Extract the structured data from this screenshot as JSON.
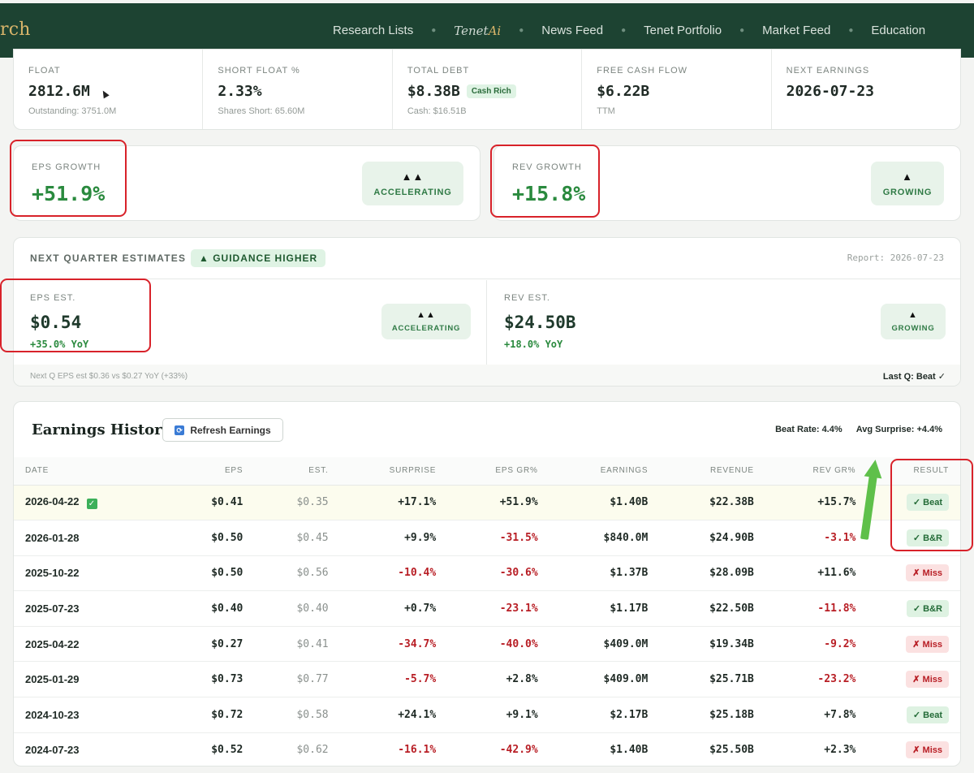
{
  "nav": {
    "brand": "rch",
    "links": [
      "Research Lists",
      "News Feed",
      "Tenet Portfolio",
      "Market Feed",
      "Education"
    ],
    "tenet_prefix": "Tenet",
    "tenet_suffix": "Ai",
    "colors": {
      "bg": "#1d4332",
      "brand": "#d9b56a"
    }
  },
  "stats": [
    {
      "label": "FLOAT",
      "value": "2812.6M",
      "sub": "Outstanding: 3751.0M"
    },
    {
      "label": "SHORT FLOAT %",
      "value": "2.33%",
      "sub": "Shares Short: 65.60M"
    },
    {
      "label": "TOTAL DEBT",
      "value": "$8.38B",
      "chip": "Cash Rich",
      "sub": "Cash: $16.51B"
    },
    {
      "label": "FREE CASH FLOW",
      "value": "$6.22B",
      "sub": "TTM"
    },
    {
      "label": "NEXT EARNINGS",
      "value": "2026-07-23",
      "sub": ""
    }
  ],
  "growth": {
    "eps": {
      "label": "EPS GROWTH",
      "value": "+51.9%",
      "arrows": "▲▲",
      "badge": "ACCELERATING"
    },
    "rev": {
      "label": "REV GROWTH",
      "value": "+15.8%",
      "arrows": "▲",
      "badge": "GROWING"
    }
  },
  "next_quarter": {
    "title": "NEXT QUARTER ESTIMATES",
    "guidance": "▲ GUIDANCE HIGHER",
    "report": "Report: 2026-07-23",
    "eps": {
      "label": "EPS EST.",
      "value": "$0.54",
      "yoy": "+35.0% YoY",
      "arrows": "▲▲",
      "badge": "ACCELERATING"
    },
    "rev": {
      "label": "REV EST.",
      "value": "$24.50B",
      "yoy": "+18.0% YoY",
      "arrows": "▲",
      "badge": "GROWING"
    },
    "note": "Next Q EPS est $0.36 vs $0.27 YoY (+33%)",
    "last_q": "Last Q: Beat ✓"
  },
  "earnings": {
    "title": "Earnings History",
    "refresh_label": "Refresh Earnings",
    "beat_rate": "Beat Rate: 4.4%",
    "avg_surprise": "Avg Surprise: +4.4%",
    "columns": [
      "DATE",
      "EPS",
      "EST.",
      "SURPRISE",
      "EPS GR%",
      "EARNINGS",
      "REVENUE",
      "REV GR%",
      "RESULT"
    ],
    "rows": [
      {
        "date": "2026-04-22",
        "eps": "$0.41",
        "est": "$0.35",
        "surprise": "+17.1%",
        "eps_gr": "+51.9%",
        "earnings": "$1.40B",
        "revenue": "$22.38B",
        "rev_gr": "+15.7%",
        "result": "✓ Beat",
        "type": "beat"
      },
      {
        "date": "2026-01-28",
        "eps": "$0.50",
        "est": "$0.45",
        "surprise": "+9.9%",
        "eps_gr": "-31.5%",
        "earnings": "$840.0M",
        "revenue": "$24.90B",
        "rev_gr": "-3.1%",
        "result": "✓ B&R",
        "type": "beat"
      },
      {
        "date": "2025-10-22",
        "eps": "$0.50",
        "est": "$0.56",
        "surprise": "-10.4%",
        "eps_gr": "-30.6%",
        "earnings": "$1.37B",
        "revenue": "$28.09B",
        "rev_gr": "+11.6%",
        "result": "✗ Miss",
        "type": "miss"
      },
      {
        "date": "2025-07-23",
        "eps": "$0.40",
        "est": "$0.40",
        "surprise": "+0.7%",
        "eps_gr": "-23.1%",
        "earnings": "$1.17B",
        "revenue": "$22.50B",
        "rev_gr": "-11.8%",
        "result": "✓ B&R",
        "type": "beat"
      },
      {
        "date": "2025-04-22",
        "eps": "$0.27",
        "est": "$0.41",
        "surprise": "-34.7%",
        "eps_gr": "-40.0%",
        "earnings": "$409.0M",
        "revenue": "$19.34B",
        "rev_gr": "-9.2%",
        "result": "✗ Miss",
        "type": "miss"
      },
      {
        "date": "2025-01-29",
        "eps": "$0.73",
        "est": "$0.77",
        "surprise": "-5.7%",
        "eps_gr": "+2.8%",
        "earnings": "$409.0M",
        "revenue": "$25.71B",
        "rev_gr": "-23.2%",
        "result": "✗ Miss",
        "type": "miss"
      },
      {
        "date": "2024-10-23",
        "eps": "$0.72",
        "est": "$0.58",
        "surprise": "+24.1%",
        "eps_gr": "+9.1%",
        "earnings": "$2.17B",
        "revenue": "$25.18B",
        "rev_gr": "+7.8%",
        "result": "✓ Beat",
        "type": "beat"
      },
      {
        "date": "2024-07-23",
        "eps": "$0.52",
        "est": "$0.62",
        "surprise": "-16.1%",
        "eps_gr": "-42.9%",
        "earnings": "$1.40B",
        "revenue": "$25.50B",
        "rev_gr": "+2.3%",
        "result": "✗ Miss",
        "type": "miss"
      }
    ]
  }
}
